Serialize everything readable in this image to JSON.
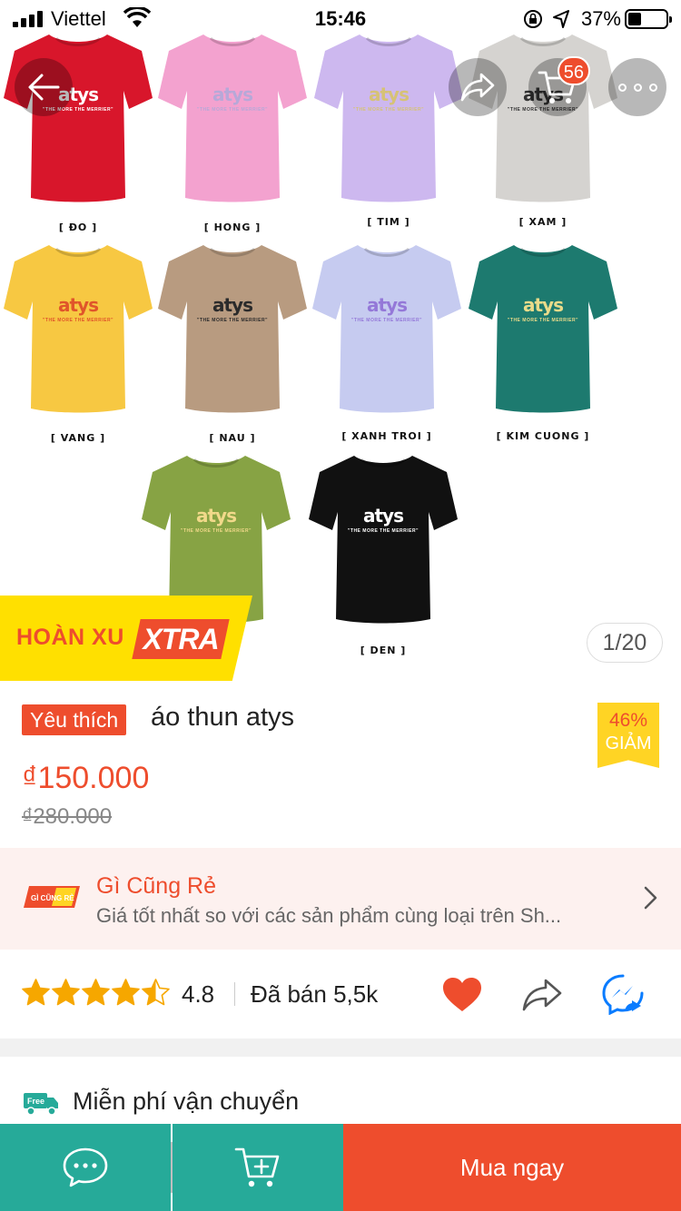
{
  "status_bar": {
    "carrier": "Viettel",
    "time": "15:46",
    "battery": "37%"
  },
  "nav": {
    "back_icon": "arrow-left-icon",
    "share_icon": "share-arrow-icon",
    "cart_icon": "cart-icon",
    "cart_count": "56",
    "more_icon": "more-dots-icon"
  },
  "gallery": {
    "counter": "1/20",
    "shirts": [
      {
        "label": "[ ĐO ]",
        "color": "#d8162b",
        "logo_color": "#ffffff"
      },
      {
        "label": "[ HONG ]",
        "color": "#f3a2cf",
        "logo_color": "#b7a8d8"
      },
      {
        "label": "[ TIM ]",
        "color": "#cdb8ef",
        "logo_color": "#d6c276"
      },
      {
        "label": "[ XAM ]",
        "color": "#d5d3d0",
        "logo_color": "#333333"
      },
      {
        "label": "[ VANG ]",
        "color": "#f7c842",
        "logo_color": "#e0552a"
      },
      {
        "label": "[ NAU ]",
        "color": "#b89b80",
        "logo_color": "#2b2b2b"
      },
      {
        "label": "[ XANH TROI ]",
        "color": "#c6cbf0",
        "logo_color": "#9478d8"
      },
      {
        "label": "[ KIM CUONG ]",
        "color": "#1d7a6f",
        "logo_color": "#e9db8a"
      },
      {
        "label": "",
        "color": "#87a344",
        "logo_color": "#f1d98a"
      },
      {
        "label": "[ DEN ]",
        "color": "#111111",
        "logo_color": "#ffffff"
      }
    ],
    "brand": "atys",
    "tagline": "\"THE MORE THE MERRIER\""
  },
  "promo": {
    "hoan_xu": "HOÀN XU",
    "xtra": "XTRA"
  },
  "product": {
    "badge": "Yêu thích",
    "title": "áo thun atys",
    "discount_pct": "46%",
    "discount_label": "GIẢM",
    "price": "₫150.000",
    "old_price": "₫280.000"
  },
  "deal": {
    "logo_icon": "gi-cung-re-logo",
    "logo_text": "GÌ CŨNG RẺ",
    "title": "Gì Cũng Rẻ",
    "description": "Giá tốt nhất so với các sản phẩm cùng loại trên Sh...",
    "chevron_icon": "chevron-right-icon"
  },
  "rating": {
    "value": "4.8",
    "stars": 4.5,
    "sold": "Đã bán 5,5k",
    "like_icon": "heart-icon",
    "share_icon": "share-icon",
    "messenger_icon": "messenger-share-icon",
    "colors": {
      "star": "#f6a700",
      "heart": "#ee4d2d",
      "messenger": "#0a7cff"
    }
  },
  "shipping": {
    "title": "Miễn phí vận chuyển",
    "truck_badge": "Free"
  },
  "bottom_bar": {
    "chat_icon": "chat-icon",
    "add_cart_icon": "add-to-cart-icon",
    "buy_label": "Mua ngay",
    "colors": {
      "teal": "#26aa99",
      "orange": "#ee4d2d"
    }
  }
}
